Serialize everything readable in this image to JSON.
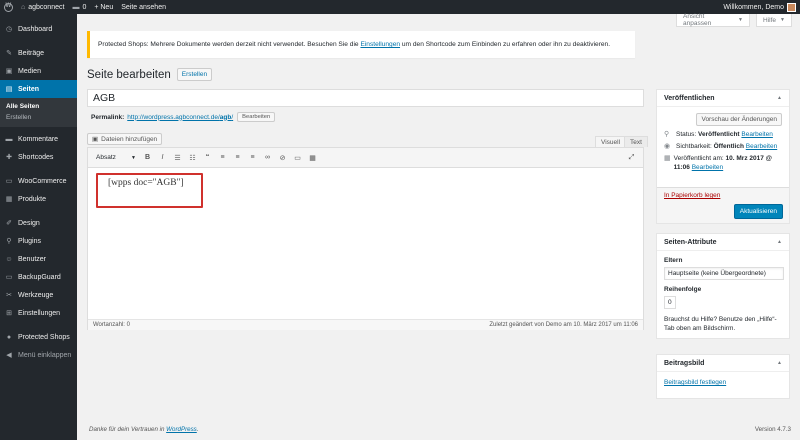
{
  "adminbar": {
    "site_name": "agbconnect",
    "comments_count": "0",
    "new_label": "+ Neu",
    "view_page_label": "Seite ansehen",
    "greeting": "Willkommen, Demo"
  },
  "sidebar": {
    "items": [
      {
        "label": "Dashboard",
        "icon": "dashboard-icon",
        "glyph": "◷"
      },
      {
        "label": "Beiträge",
        "icon": "pin-icon",
        "glyph": "✎"
      },
      {
        "label": "Medien",
        "icon": "media-icon",
        "glyph": "▣"
      },
      {
        "label": "Seiten",
        "icon": "pages-icon",
        "glyph": "▤"
      },
      {
        "label": "Kommentare",
        "icon": "comments-icon",
        "glyph": "▬"
      },
      {
        "label": "Shortcodes",
        "icon": "shortcodes-icon",
        "glyph": "✚"
      },
      {
        "label": "WooCommerce",
        "icon": "woocommerce-icon",
        "glyph": "▭"
      },
      {
        "label": "Produkte",
        "icon": "products-icon",
        "glyph": "▦"
      },
      {
        "label": "Design",
        "icon": "design-icon",
        "glyph": "✐"
      },
      {
        "label": "Plugins",
        "icon": "plugins-icon",
        "glyph": "⚲"
      },
      {
        "label": "Benutzer",
        "icon": "users-icon",
        "glyph": "☺"
      },
      {
        "label": "BackupGuard",
        "icon": "backup-icon",
        "glyph": "▭"
      },
      {
        "label": "Werkzeuge",
        "icon": "tools-icon",
        "glyph": "✂"
      },
      {
        "label": "Einstellungen",
        "icon": "settings-icon",
        "glyph": "⊞"
      },
      {
        "label": "Protected Shops",
        "icon": "protected-shops-icon",
        "glyph": "●"
      },
      {
        "label": "Menü einklappen",
        "icon": "collapse-icon",
        "glyph": "◀"
      }
    ],
    "submenu": [
      "Alle Seiten",
      "Erstellen"
    ]
  },
  "screen_meta": {
    "options_label": "Ansicht anpassen",
    "help_label": "Hilfe"
  },
  "notice": {
    "text_before": "Protected Shops: Mehrere Dokumente werden derzeit nicht verwendet. Besuchen Sie die ",
    "link": "Einstellungen",
    "text_after": " um den Shortcode zum Einbinden zu erfahren oder ihn zu deaktivieren."
  },
  "heading": {
    "title": "Seite bearbeiten",
    "add_new": "Erstellen"
  },
  "post": {
    "title": "AGB",
    "permalink_label": "Permalink:",
    "permalink_base": "http://wordpress.agbconnect.de/",
    "permalink_slug": "agb",
    "permalink_edit": "Bearbeiten"
  },
  "editor": {
    "media_button": "Dateien hinzufügen",
    "tab_visual": "Visuell",
    "tab_text": "Text",
    "format_select": "Absatz",
    "content": "[wpps doc=\"AGB\"]",
    "word_count": "Wortanzahl: 0",
    "last_edited": "Zuletzt geändert von Demo am 10. März 2017 um 11:06"
  },
  "publish_box": {
    "title": "Veröffentlichen",
    "preview": "Vorschau der Änderungen",
    "status_label": "Status:",
    "status_value": "Veröffentlicht",
    "visibility_label": "Sichtbarkeit:",
    "visibility_value": "Öffentlich",
    "published_label": "Veröffentlicht am:",
    "published_value": "10. Mrz 2017 @ 11:06",
    "edit_link": "Bearbeiten",
    "trash": "In Papierkorb legen",
    "update": "Aktualisieren"
  },
  "page_attributes": {
    "title": "Seiten-Attribute",
    "parent_label": "Eltern",
    "parent_value": "Hauptseite (keine Übergeordnete)",
    "order_label": "Reihenfolge",
    "order_value": "0",
    "help": "Brauchst du Hilfe? Benutze den „Hilfe“-Tab oben am Bildschirm."
  },
  "featured_image": {
    "title": "Beitragsbild",
    "link": "Beitragsbild festlegen"
  },
  "footer": {
    "thanks_before": "Danke für dein Vertrauen in ",
    "thanks_link": "WordPress",
    "thanks_after": ".",
    "version": "Version 4.7.3"
  }
}
